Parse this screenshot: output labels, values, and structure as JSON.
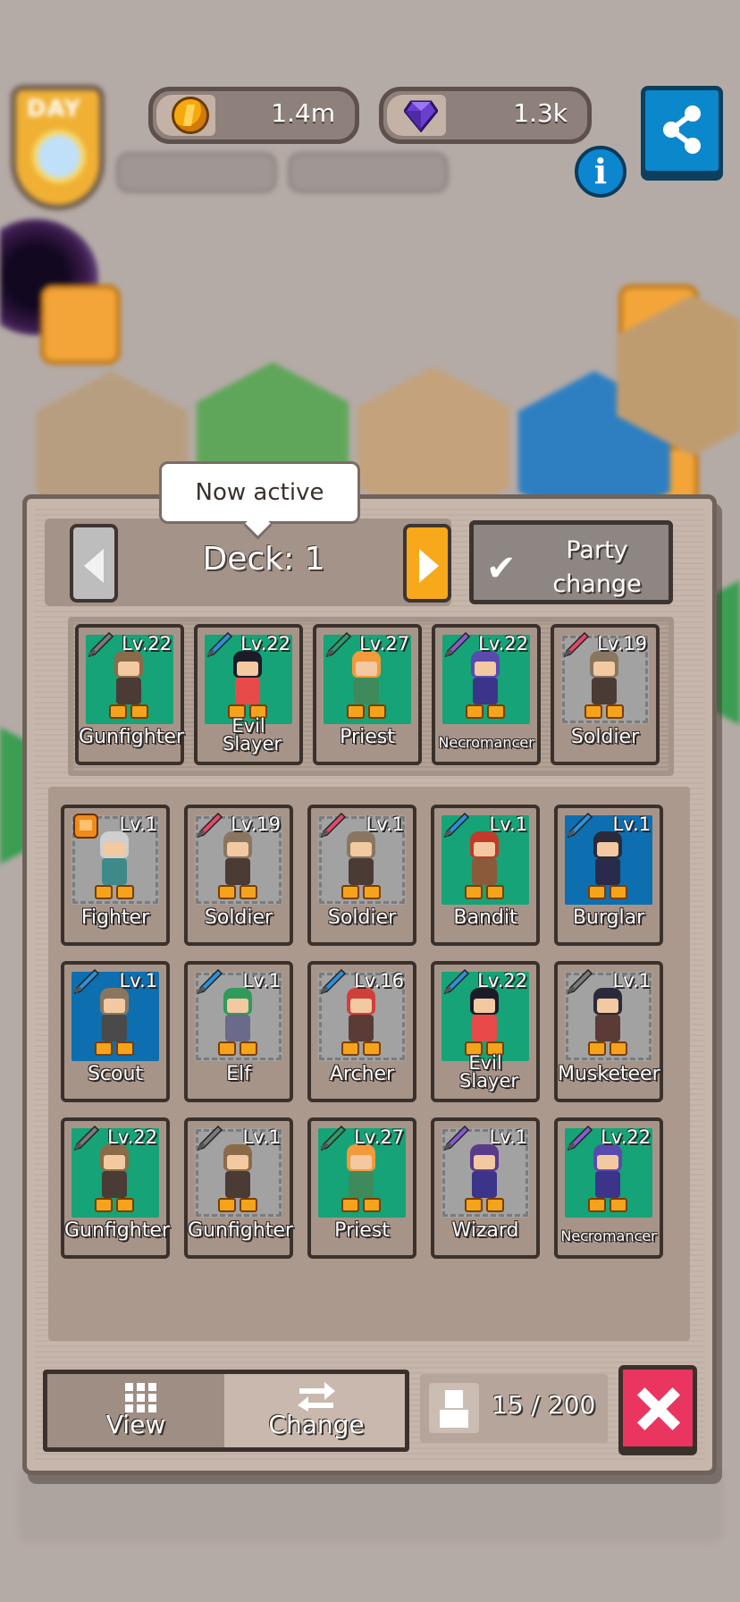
{
  "hud": {
    "coins": "1.4m",
    "gems": "1.3k",
    "day_label": "DAY"
  },
  "deck": {
    "tooltip": "Now active",
    "label": "Deck: 1",
    "party_change_line1": "Party",
    "party_change_line2": "change"
  },
  "party": [
    {
      "level": "Lv.22",
      "name": "Gunfighter",
      "weapon": "gun-icon",
      "bg": "green",
      "hair": "#8b6a4a",
      "outfit": "#4a3b35"
    },
    {
      "level": "Lv.22",
      "name": "Evil Slayer",
      "weapon": "blue-sword-icon",
      "bg": "green",
      "hair": "#1b1b2a",
      "outfit": "#e84a4a"
    },
    {
      "level": "Lv.27",
      "name": "Priest",
      "weapon": "green-staff-icon",
      "bg": "green",
      "hair": "#f39a3a",
      "outfit": "#3e8a5a"
    },
    {
      "level": "Lv.22",
      "name": "Necromancer",
      "weapon": "purple-staff-icon",
      "bg": "green",
      "hair": "#5a4ab0",
      "outfit": "#3b348a"
    },
    {
      "level": "Lv.19",
      "name": "Soldier",
      "weapon": "red-dagger-icon",
      "bg": "gray",
      "hair": "#8a7660",
      "outfit": "#4a3b35"
    }
  ],
  "roster": [
    {
      "level": "Lv.1",
      "name": "Fighter",
      "weapon": "fist-icon",
      "bg": "gray",
      "hair": "#cfcfcf",
      "outfit": "#3e8a8a"
    },
    {
      "level": "Lv.19",
      "name": "Soldier",
      "weapon": "red-dagger-icon",
      "bg": "gray",
      "hair": "#8a7660",
      "outfit": "#4a3b35"
    },
    {
      "level": "Lv.1",
      "name": "Soldier",
      "weapon": "red-dagger-icon",
      "bg": "gray",
      "hair": "#8a7660",
      "outfit": "#4a3b35"
    },
    {
      "level": "Lv.1",
      "name": "Bandit",
      "weapon": "blue-spear-icon",
      "bg": "green",
      "hair": "#c23a2a",
      "outfit": "#8a5a3a"
    },
    {
      "level": "Lv.1",
      "name": "Burglar",
      "weapon": "blue-spear-icon",
      "bg": "blue",
      "hair": "#2a2a3a",
      "outfit": "#2a2a4a"
    },
    {
      "level": "Lv.1",
      "name": "Scout",
      "weapon": "blue-spear-icon",
      "bg": "blue",
      "hair": "#8a7660",
      "outfit": "#4a4a4a"
    },
    {
      "level": "Lv.1",
      "name": "Elf",
      "weapon": "blue-sword-icon",
      "bg": "gray",
      "hair": "#2f9a5a",
      "outfit": "#6a6a8a"
    },
    {
      "level": "Lv.16",
      "name": "Archer",
      "weapon": "blue-sword-icon",
      "bg": "gray",
      "hair": "#d0403a",
      "outfit": "#5a3b35"
    },
    {
      "level": "Lv.22",
      "name": "Evil Slayer",
      "weapon": "blue-sword-icon",
      "bg": "green",
      "hair": "#1b1b2a",
      "outfit": "#e84a4a"
    },
    {
      "level": "Lv.1",
      "name": "Musketeer",
      "weapon": "gun-icon",
      "bg": "gray",
      "hair": "#2a2a3a",
      "outfit": "#5a3b35"
    },
    {
      "level": "Lv.22",
      "name": "Gunfighter",
      "weapon": "gun-icon",
      "bg": "green",
      "hair": "#8b6a4a",
      "outfit": "#4a3b35"
    },
    {
      "level": "Lv.1",
      "name": "Gunfighter",
      "weapon": "gun-icon",
      "bg": "gray",
      "hair": "#8b6a4a",
      "outfit": "#4a3b35"
    },
    {
      "level": "Lv.27",
      "name": "Priest",
      "weapon": "green-staff-icon",
      "bg": "green",
      "hair": "#f39a3a",
      "outfit": "#3e8a5a"
    },
    {
      "level": "Lv.1",
      "name": "Wizard",
      "weapon": "purple-staff-icon",
      "bg": "gray",
      "hair": "#5a3b8a",
      "outfit": "#3b348a"
    },
    {
      "level": "Lv.22",
      "name": "Necromancer",
      "weapon": "purple-staff-icon",
      "bg": "green",
      "hair": "#5a4ab0",
      "outfit": "#3b348a"
    }
  ],
  "bottom": {
    "view_label": "View",
    "change_label": "Change",
    "unit_count": "15 / 200"
  },
  "colors": {
    "accent_orange": "#f7a81b",
    "close_red": "#e9355f",
    "share_blue": "#0b87cc"
  }
}
